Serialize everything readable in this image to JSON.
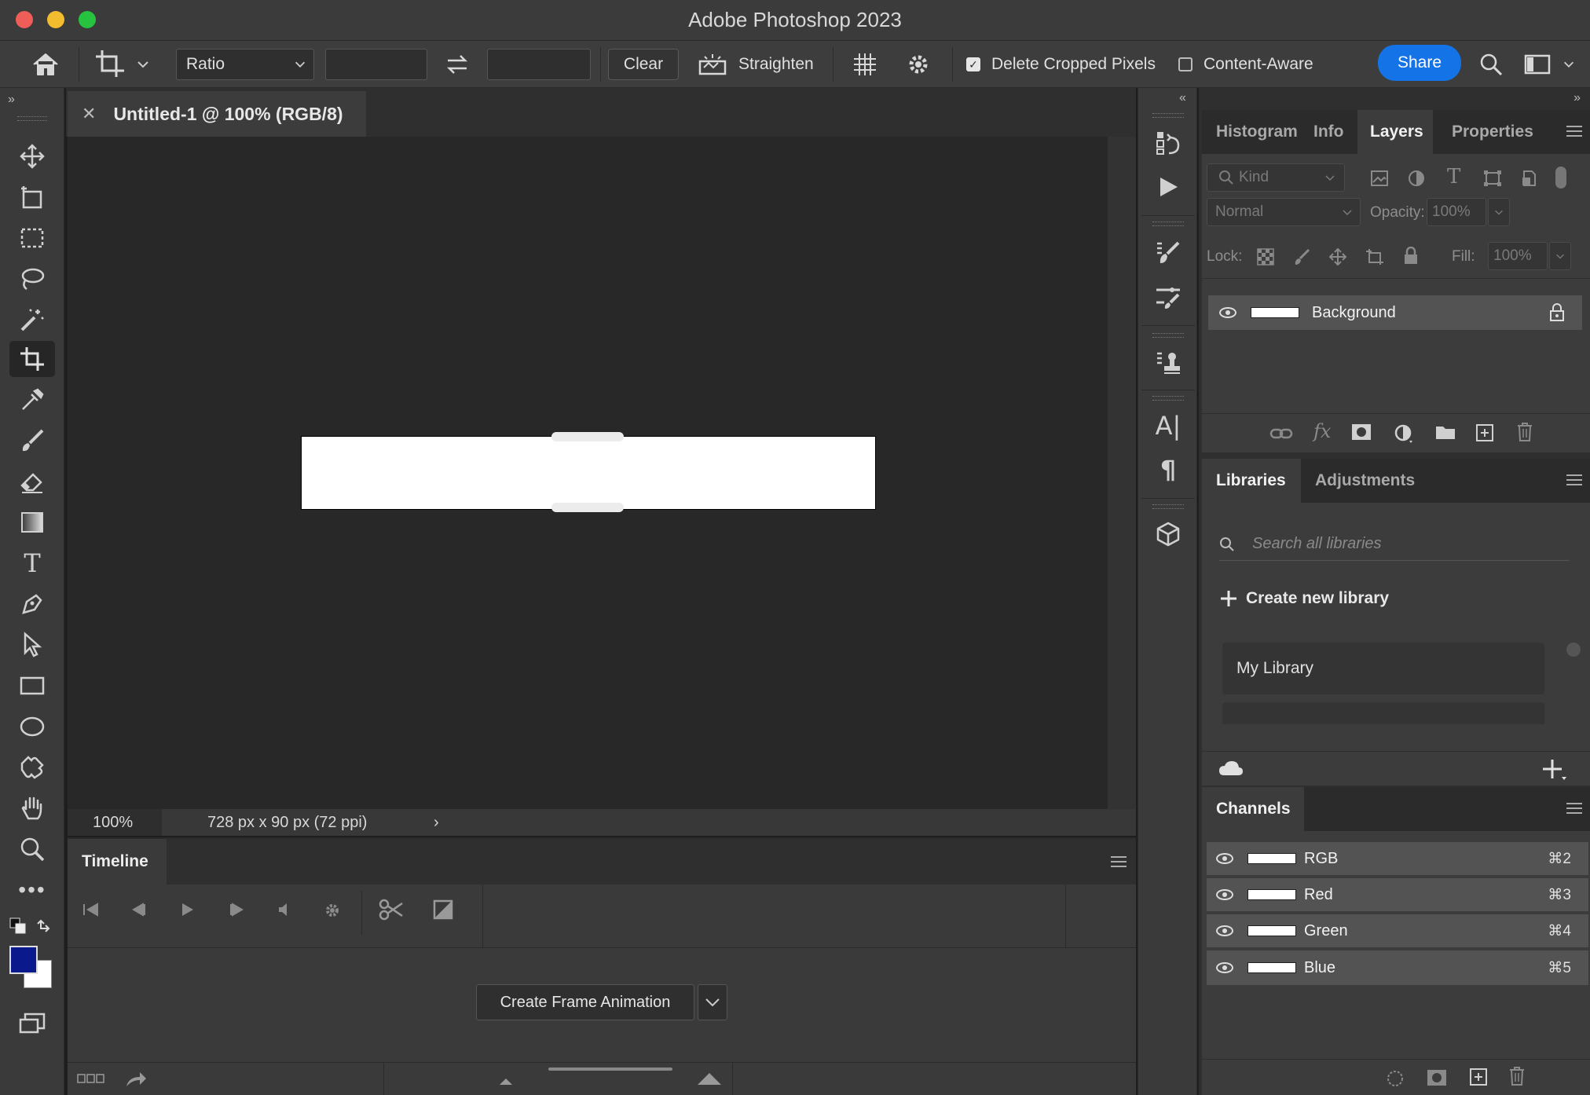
{
  "app": {
    "title": "Adobe Photoshop 2023"
  },
  "options_bar": {
    "ratio_select": "Ratio",
    "clear_label": "Clear",
    "straighten_label": "Straighten",
    "delete_cropped_label": "Delete Cropped Pixels",
    "delete_cropped_checked": true,
    "content_aware_label": "Content-Aware",
    "content_aware_checked": false,
    "share_label": "Share"
  },
  "document": {
    "tab_title": "Untitled-1 @ 100% (RGB/8)",
    "zoom": "100%",
    "info": "728 px x 90 px (72 ppi)"
  },
  "timeline": {
    "tab": "Timeline",
    "create_button": "Create Frame Animation"
  },
  "colors": {
    "foreground": "#0a1a8c",
    "background": "#ffffff",
    "accent": "#1473e6"
  },
  "layers_panel": {
    "tabs": [
      "Histogram",
      "Info",
      "Layers",
      "Properties"
    ],
    "active_tab": "Layers",
    "kind_placeholder": "Kind",
    "blend_mode": "Normal",
    "opacity_label": "Opacity:",
    "opacity_value": "100%",
    "lock_label": "Lock:",
    "fill_label": "Fill:",
    "fill_value": "100%",
    "layers": [
      {
        "name": "Background",
        "locked": true
      }
    ]
  },
  "libraries_panel": {
    "tabs": [
      "Libraries",
      "Adjustments"
    ],
    "active_tab": "Libraries",
    "search_placeholder": "Search all libraries",
    "create_label": "Create new library",
    "items": [
      "My Library"
    ]
  },
  "channels_panel": {
    "tab": "Channels",
    "channels": [
      {
        "name": "RGB",
        "shortcut": "⌘2"
      },
      {
        "name": "Red",
        "shortcut": "⌘3"
      },
      {
        "name": "Green",
        "shortcut": "⌘4"
      },
      {
        "name": "Blue",
        "shortcut": "⌘5"
      }
    ]
  }
}
